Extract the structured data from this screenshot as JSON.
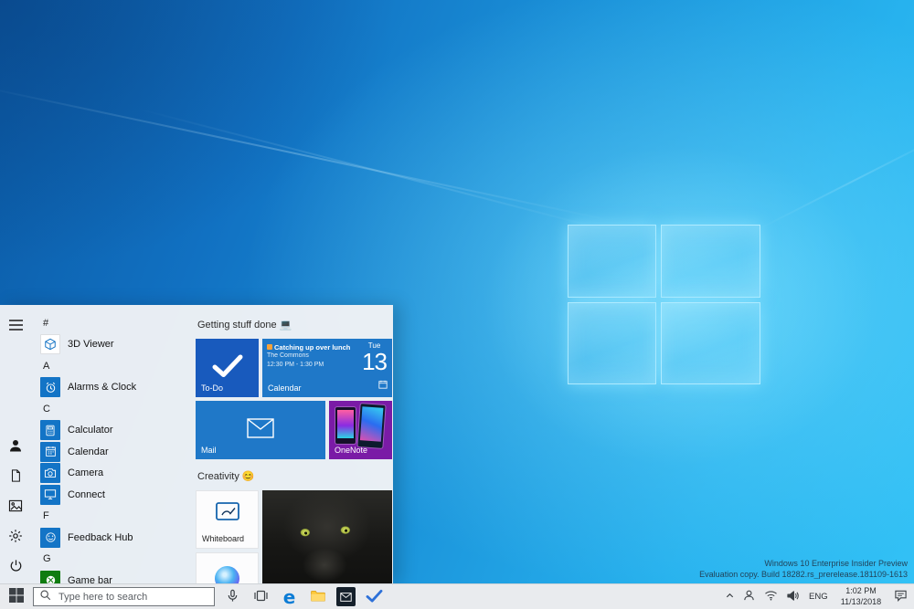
{
  "wallpaper": {
    "watermark_line1": "Windows 10 Enterprise Insider Preview",
    "watermark_line2": "Evaluation copy. Build 18282.rs_prerelease.181109-1613"
  },
  "start_menu": {
    "app_list": [
      {
        "type": "header",
        "label": "#"
      },
      {
        "type": "app",
        "label": "3D Viewer"
      },
      {
        "type": "header",
        "label": "A"
      },
      {
        "type": "app",
        "label": "Alarms & Clock"
      },
      {
        "type": "header",
        "label": "C"
      },
      {
        "type": "app",
        "label": "Calculator"
      },
      {
        "type": "app",
        "label": "Calendar"
      },
      {
        "type": "app",
        "label": "Camera"
      },
      {
        "type": "app",
        "label": "Connect"
      },
      {
        "type": "header",
        "label": "F"
      },
      {
        "type": "app",
        "label": "Feedback Hub"
      },
      {
        "type": "header",
        "label": "G"
      },
      {
        "type": "app",
        "label": "Game bar"
      }
    ],
    "tile_sections": [
      {
        "title": "Getting stuff done 💻"
      },
      {
        "title": "Creativity 😊"
      }
    ],
    "tiles": {
      "todo": {
        "label": "To-Do"
      },
      "calendar": {
        "label": "Calendar",
        "event_title": "Catching up over lunch",
        "event_location": "The Commons",
        "event_time": "12:30 PM - 1:30 PM",
        "day_name": "Tue",
        "day_number": "13"
      },
      "mail": {
        "label": "Mail"
      },
      "onenote": {
        "label": "OneNote"
      },
      "whiteboard": {
        "label": "Whiteboard"
      }
    }
  },
  "taskbar": {
    "search_placeholder": "Type here to search",
    "edge_glyph": "e",
    "tray": {
      "language": "ENG",
      "time": "1:02 PM",
      "date": "11/13/2018"
    }
  },
  "colors": {
    "accent_blue": "#0078d7",
    "tile_blue": "#1f78c8",
    "todo_blue": "#185abd",
    "onenote_purple": "#7a1ba6",
    "xbox_green": "#107c10",
    "taskbar_bg": "#e9ebee"
  }
}
